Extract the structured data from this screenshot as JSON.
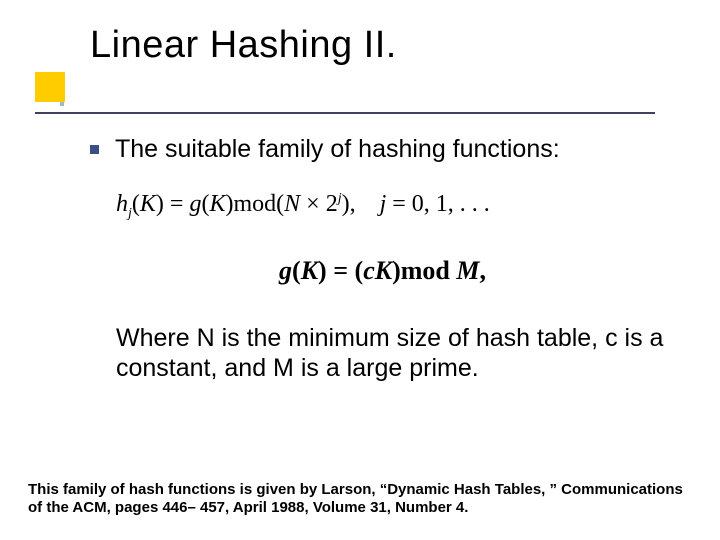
{
  "title": "Linear Hashing II.",
  "bullet": "The suitable family of hashing functions:",
  "formula1": {
    "h": "h",
    "j_sub": "j",
    "K": "K",
    "eq": " = ",
    "g": "g",
    "mod_open": "mod(",
    "N": "N",
    "times": " × ",
    "two": "2",
    "j_sup": "j",
    "close": "),",
    "j_eq": "j",
    "j_vals": " = 0, 1, . . ."
  },
  "formula2": {
    "g": "g",
    "K": "K",
    "eq": " = (",
    "cK": "cK",
    "mod": ")mod ",
    "M": "M",
    "end": ","
  },
  "explanation": "Where N is the minimum size of hash table, c is a constant, and M is a large prime.",
  "footnote": "This family of hash functions is given by Larson, “Dynamic Hash Tables, ” Communications of the ACM, pages 446– 457, April 1988, Volume 31, Number 4."
}
